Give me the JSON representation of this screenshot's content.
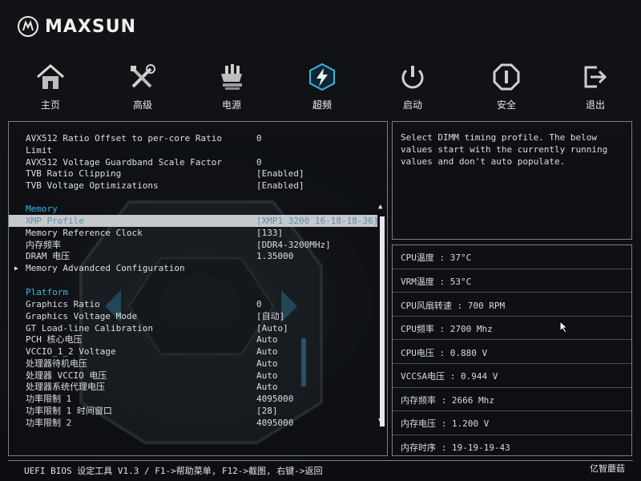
{
  "brand": {
    "name": "MAXSUN"
  },
  "nav": {
    "items": [
      {
        "label": "主页",
        "icon": "home-icon"
      },
      {
        "label": "高级",
        "icon": "tools-icon"
      },
      {
        "label": "电源",
        "icon": "power-plug-icon"
      },
      {
        "label": "超频",
        "icon": "overclock-lightning-icon"
      },
      {
        "label": "启动",
        "icon": "boot-power-icon"
      },
      {
        "label": "安全",
        "icon": "security-icon"
      },
      {
        "label": "退出",
        "icon": "exit-icon"
      }
    ],
    "active": "超频"
  },
  "settings": {
    "rows": [
      {
        "label": "AVX512 Ratio Offset to per-core Ratio",
        "value": "0"
      },
      {
        "label": "Limit",
        "value": ""
      },
      {
        "label": "AVX512 Voltage Guardband Scale Factor",
        "value": "0"
      },
      {
        "label": "TVB Ratio Clipping",
        "value": "[Enabled]"
      },
      {
        "label": "TVB Voltage Optimizations",
        "value": "[Enabled]"
      }
    ],
    "memory_section": "Memory",
    "memory_rows": [
      {
        "label": "XMP Profile",
        "value": "[XMP1 3200 16-18-18-36]"
      },
      {
        "label": "Memory Reference Clock",
        "value": "[133]"
      },
      {
        "label": "内存频率",
        "value": "[DDR4-3200MHz]"
      },
      {
        "label": "DRAM 电压",
        "value": "1.35000"
      },
      {
        "label": "Memory Advandced Configuration",
        "value": ""
      }
    ],
    "platform_section": "Platform",
    "platform_rows": [
      {
        "label": "Graphics Ratio",
        "value": "0"
      },
      {
        "label": "Graphics Voltage Mode",
        "value": "[自动]"
      },
      {
        "label": "GT Load-line Calibration",
        "value": "[Auto]"
      },
      {
        "label": "PCH 核心电压",
        "value": "Auto"
      },
      {
        "label": "VCCIO_1_2 Voltage",
        "value": "Auto"
      },
      {
        "label": "处理器待机电压",
        "value": "Auto"
      },
      {
        "label": "处理器 VCCIO 电压",
        "value": "Auto"
      },
      {
        "label": "处理器系统代理电压",
        "value": "Auto"
      },
      {
        "label": "功率限制 1",
        "value": "4095000"
      },
      {
        "label": "功率限制 1 时间窗口",
        "value": "[28]"
      },
      {
        "label": "功率限制 2",
        "value": "4095000"
      }
    ]
  },
  "help": {
    "text": "Select DIMM timing profile. The below\nvalues start with the currently running\nvalues and don't auto populate."
  },
  "monitor": [
    "CPU温度 : 37°C",
    "VRM温度 : 53°C",
    "CPU风扇转速 : 700 RPM",
    "CPU频率 : 2700 Mhz",
    "CPU电压 : 0.880 V",
    "VCCSA电压 : 0.944 V",
    "内存频率 : 2666 Mhz",
    "内存电压 : 1.200 V",
    "内存时序 : 19-19-19-43"
  ],
  "footer": {
    "text": "UEFI BIOS 设定工具 V1.3 / F1->帮助菜单, F12->截图, 右键->返回"
  },
  "watermark": {
    "text": "亿智蘑菇"
  },
  "colors": {
    "accent": "#35b8e6",
    "highlight_bg": "#c6c9cc",
    "border": "#7a7f86"
  }
}
